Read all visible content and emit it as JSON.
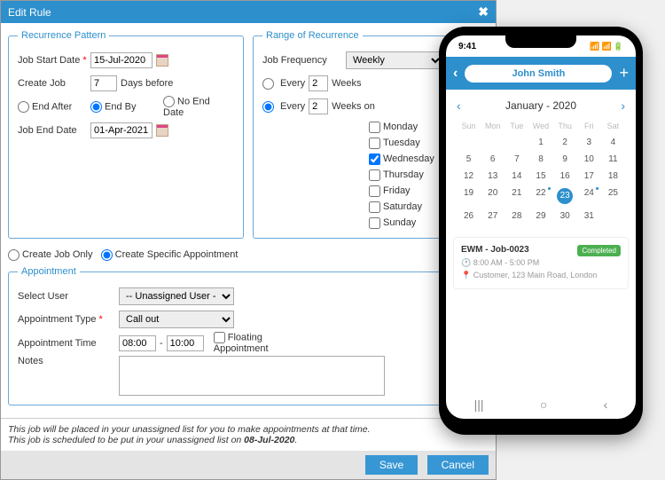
{
  "dialog": {
    "title": "Edit Rule",
    "recurrence": {
      "legend": "Recurrence Pattern",
      "start_label": "Job Start Date",
      "start_value": "15-Jul-2020",
      "create_label": "Create Job",
      "create_value": "7",
      "create_suffix": "Days before",
      "end_after": "End After",
      "end_by": "End By",
      "no_end": "No End Date",
      "end_label": "Job End Date",
      "end_value": "01-Apr-2021"
    },
    "range": {
      "legend": "Range of Recurrence",
      "freq_label": "Job Frequency",
      "freq_value": "Weekly",
      "every1_label": "Every",
      "every1_value": "2",
      "every1_suffix": "Weeks",
      "every2_label": "Every",
      "every2_value": "2",
      "every2_suffix": "Weeks on",
      "days": [
        "Monday",
        "Tuesday",
        "Wednesday",
        "Thursday",
        "Friday",
        "Saturday",
        "Sunday"
      ],
      "checked_day_index": 2
    },
    "create_opts": {
      "a": "Create Job Only",
      "b": "Create Specific Appointment"
    },
    "appointment": {
      "legend": "Appointment",
      "user_label": "Select User",
      "user_value": "-- Unassigned User --",
      "type_label": "Appointment Type",
      "type_value": "Call out",
      "time_label": "Appointment Time",
      "time_from": "08:00",
      "time_to": "10:00",
      "floating_label": "Floating Appointment",
      "notes_label": "Notes"
    },
    "footer1": "This job will be placed in your unassigned list for you to make appointments at that time.",
    "footer2a": "This job is scheduled to be put in your unassigned list on ",
    "footer2b": "08-Jul-2020",
    "save": "Save",
    "cancel": "Cancel"
  },
  "phone": {
    "time": "9:41",
    "user": "John Smith",
    "month": "January - 2020",
    "dow": [
      "Sun",
      "Mon",
      "Tue",
      "Wed",
      "Thu",
      "Fri",
      "Sat"
    ],
    "weeks": [
      [
        "",
        "",
        "",
        "1",
        "2",
        "3",
        "4"
      ],
      [
        "5",
        "6",
        "7",
        "8",
        "9",
        "10",
        "11"
      ],
      [
        "12",
        "13",
        "14",
        "15",
        "16",
        "17",
        "18"
      ],
      [
        "19",
        "20",
        "21",
        "22",
        "23",
        "24",
        "25"
      ],
      [
        "26",
        "27",
        "28",
        "29",
        "30",
        "31",
        ""
      ]
    ],
    "today": "23",
    "dotted": [
      "22",
      "24"
    ],
    "job": {
      "title": "EWM - Job-0023",
      "time": "8:00 AM - 5:00 PM",
      "loc": "Customer, 123 Main Road, London",
      "status": "Completed"
    }
  }
}
